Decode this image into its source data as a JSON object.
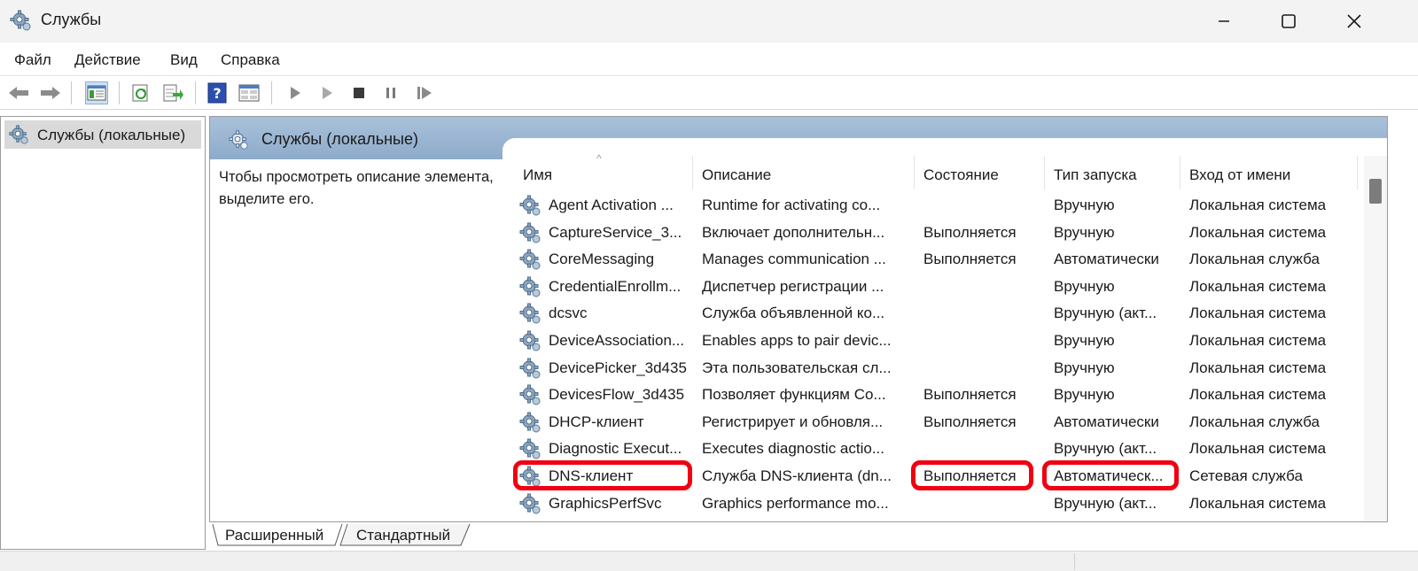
{
  "window": {
    "title": "Службы",
    "icon": "gear-icon"
  },
  "menu": [
    "Файл",
    "Действие",
    "Вид",
    "Справка"
  ],
  "toolbar": {
    "icons": [
      "back-arrow-icon",
      "forward-arrow-icon",
      "show-console-tree-icon",
      "refresh-icon",
      "export-list-icon",
      "help-icon",
      "properties-icon",
      "play-icon",
      "play-outline-icon",
      "stop-icon",
      "pause-icon",
      "resume-icon"
    ]
  },
  "tree": {
    "selected": "Службы (локальные)"
  },
  "main": {
    "header": "Службы (локальные)",
    "description": "Чтобы просмотреть описание элемента, выделите его.",
    "columns": [
      "Имя",
      "Описание",
      "Состояние",
      "Тип запуска",
      "Вход от имени"
    ],
    "rows": [
      [
        "Agent Activation ...",
        "Runtime for activating co...",
        "",
        "Вручную",
        "Локальная система"
      ],
      [
        "CaptureService_3...",
        "Включает дополнительн...",
        "Выполняется",
        "Вручную",
        "Локальная система"
      ],
      [
        "CoreMessaging",
        "Manages communication ...",
        "Выполняется",
        "Автоматически",
        "Локальная служба"
      ],
      [
        "CredentialEnrollm...",
        "Диспетчер регистрации ...",
        "",
        "Вручную",
        "Локальная система"
      ],
      [
        "dcsvc",
        "Служба объявленной ко...",
        "",
        "Вручную (акт...",
        "Локальная система"
      ],
      [
        "DeviceAssociation...",
        "Enables apps to pair devic...",
        "",
        "Вручную",
        "Локальная система"
      ],
      [
        "DevicePicker_3d435",
        "Эта пользовательская сл...",
        "",
        "Вручную",
        "Локальная система"
      ],
      [
        "DevicesFlow_3d435",
        "Позволяет функциям Co...",
        "Выполняется",
        "Вручную",
        "Локальная система"
      ],
      [
        "DHCP-клиент",
        "Регистрирует и обновля...",
        "Выполняется",
        "Автоматически",
        "Локальная служба"
      ],
      [
        "Diagnostic Execut...",
        "Executes diagnostic actio...",
        "",
        "Вручную (акт...",
        "Локальная система"
      ],
      [
        "DNS-клиент",
        "Служба DNS-клиента (dn...",
        "Выполняется",
        "Автоматическ...",
        "Сетевая служба"
      ],
      [
        "GraphicsPerfSvc",
        "Graphics performance mo...",
        "",
        "Вручную (акт...",
        "Локальная система"
      ]
    ]
  },
  "tabs": [
    "Расширенный",
    "Стандартный"
  ],
  "colors": {
    "header_band": "#8eabcb",
    "highlight": "#f00010",
    "selected_tree": "#d9d9d9"
  }
}
